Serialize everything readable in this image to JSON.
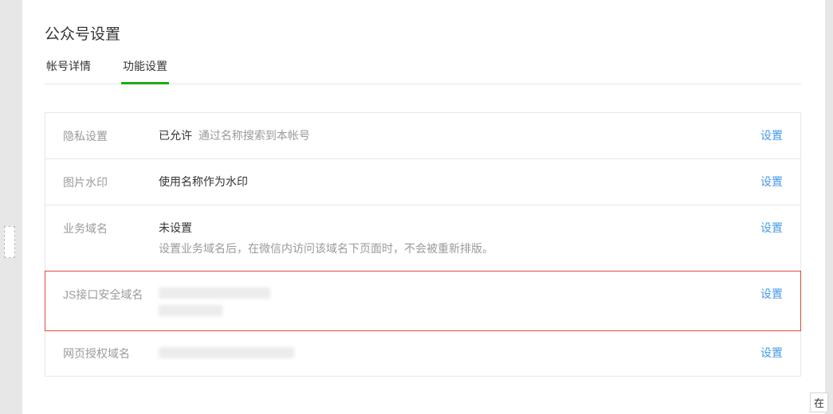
{
  "page": {
    "title": "公众号设置"
  },
  "tabs": {
    "account_details": "帐号详情",
    "function_settings": "功能设置"
  },
  "rows": {
    "privacy": {
      "label": "隐私设置",
      "status": "已允许",
      "status_desc": "通过名称搜索到本帐号",
      "action": "设置"
    },
    "watermark": {
      "label": "图片水印",
      "value": "使用名称作为水印",
      "action": "设置"
    },
    "biz_domain": {
      "label": "业务域名",
      "value": "未设置",
      "desc": "设置业务域名后，在微信内访问该域名下页面时，不会被重新排版。",
      "action": "设置"
    },
    "js_domain": {
      "label": "JS接口安全域名",
      "action": "设置"
    },
    "oauth_domain": {
      "label": "网页授权域名",
      "action": "设置"
    }
  },
  "misc": {
    "corner_char": "在"
  }
}
